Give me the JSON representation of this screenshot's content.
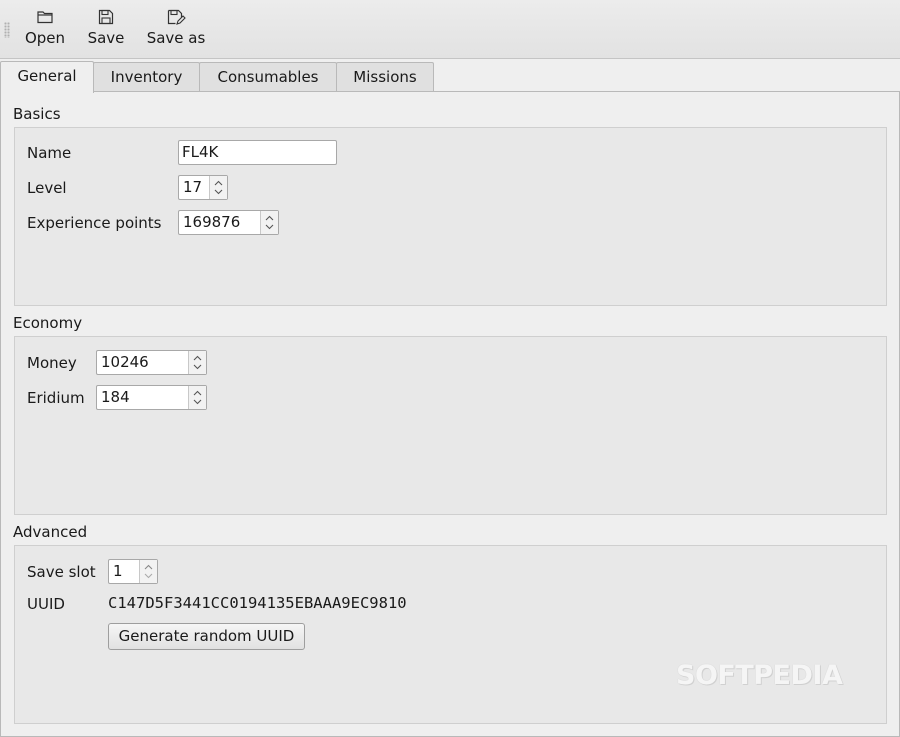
{
  "toolbar": {
    "open_label": "Open",
    "save_label": "Save",
    "save_as_label": "Save as"
  },
  "tabs": [
    {
      "label": "General",
      "active": true
    },
    {
      "label": "Inventory",
      "active": false
    },
    {
      "label": "Consumables",
      "active": false
    },
    {
      "label": "Missions",
      "active": false
    }
  ],
  "basics": {
    "title": "Basics",
    "name_label": "Name",
    "name_value": "FL4K",
    "level_label": "Level",
    "level_value": "17",
    "xp_label": "Experience points",
    "xp_value": "169876"
  },
  "economy": {
    "title": "Economy",
    "money_label": "Money",
    "money_value": "10246",
    "eridium_label": "Eridium",
    "eridium_value": "184"
  },
  "advanced": {
    "title": "Advanced",
    "save_slot_label": "Save slot",
    "save_slot_value": "1",
    "uuid_label": "UUID",
    "uuid_value": "C147D5F3441CC0194135EBAAA9EC9810",
    "generate_button": "Generate random UUID"
  },
  "watermark": "SOFTPEDIA",
  "icons": {
    "open": "folder-icon",
    "save": "floppy-icon",
    "save_as": "floppy-pencil-icon",
    "spin_up": "chevron-up-icon",
    "spin_down": "chevron-down-icon"
  }
}
